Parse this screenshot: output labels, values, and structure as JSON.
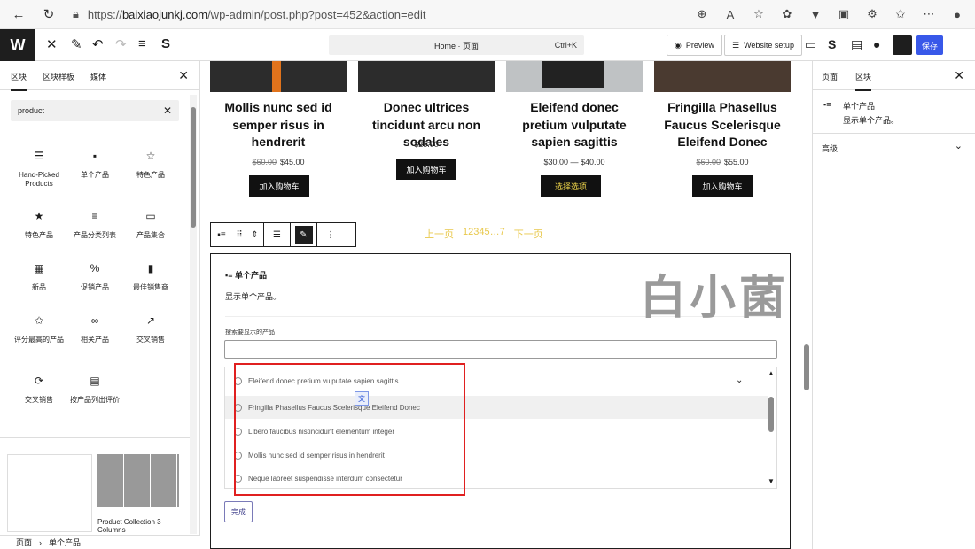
{
  "browser": {
    "url_prefix": "https://",
    "url_domain": "baixiaojunkj.com",
    "url_path": "/wp-admin/post.php?post=452&action=edit"
  },
  "wp": {
    "logo": "W",
    "command": "Home · 页面",
    "command_shortcut": "Ctrl+K",
    "preview": "Preview",
    "website_setup": "Website setup",
    "save": "保存"
  },
  "inserter": {
    "tabs": [
      "区块",
      "区块样板",
      "媒体"
    ],
    "search_value": "product",
    "blocks": [
      {
        "icon": "☰",
        "label": "Hand-Picked Products"
      },
      {
        "icon": "▪",
        "label": "单个产品"
      },
      {
        "icon": "☆",
        "label": "特色产品"
      },
      {
        "icon": "★",
        "label": "特色产品"
      },
      {
        "icon": "≡",
        "label": "产品分类列表"
      },
      {
        "icon": "▭",
        "label": "产品集合"
      },
      {
        "icon": "▦",
        "label": "新品"
      },
      {
        "icon": "%",
        "label": "促销产品"
      },
      {
        "icon": "▮",
        "label": "最佳销售商"
      },
      {
        "icon": "✩",
        "label": "评分最高的产品"
      },
      {
        "icon": "∞",
        "label": "相关产品"
      },
      {
        "icon": "↗",
        "label": "交叉销售"
      },
      {
        "icon": "⟳",
        "label": "交叉销售"
      },
      {
        "icon": "▤",
        "label": "按产品列出评价"
      }
    ],
    "pattern_label": "Product Collection 3 Columns"
  },
  "breadcrumb": {
    "root": "页面",
    "sep": "›",
    "current": "单个产品"
  },
  "products": [
    {
      "title": "Mollis nunc sed id semper risus in hendrerit",
      "old": "$60.00",
      "price": "$45.00",
      "button": "加入购物车"
    },
    {
      "title": "Donec ultrices tincidunt arcu non sodales",
      "old": "",
      "price": "$25.00",
      "button": "加入购物车"
    },
    {
      "title": "Eleifend donec pretium vulputate sapien sagittis",
      "old": "",
      "price": "$30.00 — $40.00",
      "button": "选择选项"
    },
    {
      "title": "Fringilla Phasellus Faucus Scelerisque Eleifend Donec",
      "old": "$60.00",
      "price": "$55.00",
      "button": "加入购物车"
    }
  ],
  "pager": {
    "prev": "上一页",
    "pages": "12345…7",
    "next": "下一页"
  },
  "watermark": "白小菌",
  "block": {
    "title": "单个产品",
    "desc": "显示单个产品。",
    "search_label": "搜索要显示的产品",
    "options": [
      "Eleifend donec pretium vulputate sapien sagittis",
      "Fringilla Phasellus Faucus Scelerisque Eleifend Donec",
      "Libero faucibus nistincidunt elementum integer",
      "Mollis nunc sed id semper risus in hendrerit",
      "Neque laoreet suspendisse interdum consectetur"
    ],
    "done": "完成"
  },
  "settings": {
    "tabs": [
      "页面",
      "区块"
    ],
    "title": "单个产品",
    "desc": "显示单个产品。",
    "advanced": "高级"
  }
}
